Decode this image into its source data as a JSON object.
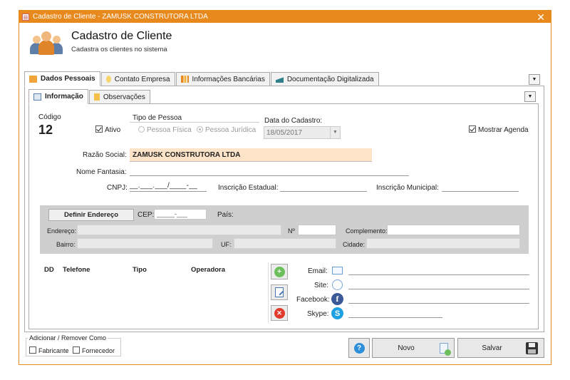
{
  "window": {
    "title": "Cadastro de Cliente - ZAMUSK CONSTRUTORA LTDA",
    "close_glyph": "✕"
  },
  "header": {
    "title": "Cadastro de Cliente",
    "subtitle": "Cadastra os clientes no sistema",
    "icon": "users-icon"
  },
  "outer_tabs": [
    {
      "label": "Dados Pessoais",
      "icon": "folder-icon",
      "active": true
    },
    {
      "label": "Contato Empresa",
      "icon": "lightbulb-icon",
      "active": false
    },
    {
      "label": "Informações Bancárias",
      "icon": "bar-chart-icon",
      "active": false
    },
    {
      "label": "Documentação Digitalizada",
      "icon": "scanner-icon",
      "active": false
    }
  ],
  "inner_tabs": [
    {
      "label": "Informação",
      "icon": "window-icon",
      "active": true
    },
    {
      "label": "Observações",
      "icon": "note-icon",
      "active": false
    }
  ],
  "form": {
    "codigo_label": "Código",
    "codigo_value": "12",
    "ativo_label": "Ativo",
    "ativo_checked": true,
    "tipo_pessoa_label": "Tipo de Pessoa",
    "pessoa_fisica_label": "Pessoa Física",
    "pessoa_juridica_label": "Pessoa Jurídica",
    "pessoa_selected": "juridica",
    "data_cadastro_label": "Data do Cadastro:",
    "data_cadastro_value": "18/05/2017",
    "mostrar_agenda_label": "Mostrar Agenda",
    "mostrar_agenda_checked": true,
    "razao_social_label": "Razão Social:",
    "razao_social_value": "ZAMUSK CONSTRUTORA LTDA",
    "nome_fantasia_label": "Nome Fantasia:",
    "nome_fantasia_value": "",
    "cnpj_label": "CNPJ:",
    "cnpj_value": "__.___.___/____-__",
    "inscricao_estadual_label": "Inscrição Estadual:",
    "inscricao_municipal_label": "Inscrição Municipal:"
  },
  "address": {
    "definir_button": "Definir Endereço",
    "cep_label": "CEP:",
    "cep_value": "_____-___",
    "pais_label": "País:",
    "endereco_label": "Endereço:",
    "numero_label": "Nº",
    "complemento_label": "Complemento:",
    "bairro_label": "Bairro:",
    "uf_label": "UF:",
    "cidade_label": "Cidade:"
  },
  "phones": {
    "columns": [
      "DD",
      "Telefone",
      "Tipo",
      "Operadora"
    ]
  },
  "contacts": [
    {
      "label": "Email:",
      "icon": "envelope-icon"
    },
    {
      "label": "Site:",
      "icon": "globe-icon"
    },
    {
      "label": "Facebook:",
      "icon": "facebook-icon"
    },
    {
      "label": "Skype:",
      "icon": "skype-icon"
    }
  ],
  "footer": {
    "group_label": "Adicionar / Remover Como",
    "fabricante_label": "Fabricante",
    "fornecedor_label": "Fornecedor",
    "novo_button": "Novo",
    "salvar_button": "Salvar",
    "help_glyph": "?"
  },
  "colors": {
    "accent": "#e8891d",
    "highlight_field": "#fde3c8",
    "address_panel": "#cfcfcf"
  }
}
